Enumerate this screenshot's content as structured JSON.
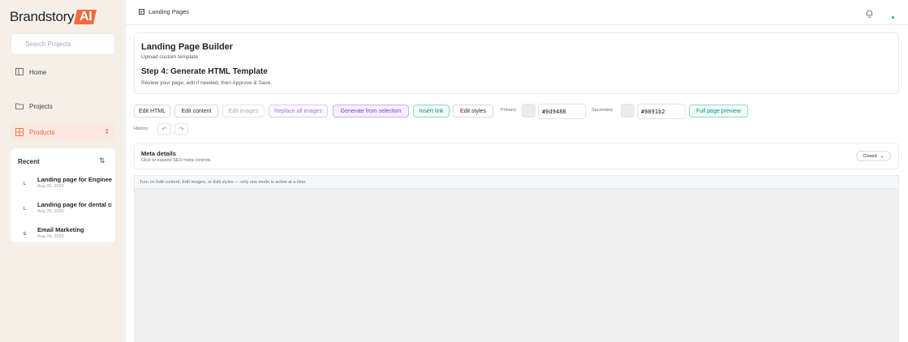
{
  "brand": {
    "name": "Brandstory",
    "ai_badge": "AI",
    "accent": "#f26b3a"
  },
  "sidebar": {
    "search_placeholder": "Search Projects",
    "nav": [
      {
        "label": "Home",
        "icon": "layout-icon"
      },
      {
        "label": "Projects",
        "icon": "folder-icon"
      },
      {
        "label": "Products",
        "icon": "grid-icon",
        "active": true
      }
    ],
    "recent": {
      "title": "Recent",
      "sort_icon": "sort-icon",
      "items": [
        {
          "initial": "L",
          "name": "Landing page for Engineer",
          "date": "Aug 26, 2026"
        },
        {
          "initial": "L",
          "name": "Landing page for dental cl",
          "date": "Aug 26, 2026"
        },
        {
          "initial": "E",
          "name": "Email Marketing",
          "date": "Aug 24, 2026"
        }
      ]
    }
  },
  "header": {
    "breadcrumb": "Landing Pages",
    "status_color": "#1fb27a"
  },
  "builder": {
    "title": "Landing Page Builder",
    "subtitle": "Upload custom template",
    "step": "Step 4: Generate HTML Template",
    "description": "Review your page, edit if needed, then Approve & Save."
  },
  "toolbar": {
    "edit_html": "Edit HTML",
    "edit_content": "Edit content",
    "edit_images": "Edit images",
    "replace_all_images": "Replace all images",
    "generate_from_selection": "Generate from selection",
    "insert_link": "Insert link",
    "edit_styles": "Edit styles",
    "primary_label": "Primary",
    "primary_value": "#0d9488",
    "secondary_label": "Secondary",
    "secondary_value": "#0891b2",
    "full_page_preview": "Full page preview"
  },
  "history": {
    "label": "History:",
    "undo_icon": "undo-icon",
    "redo_icon": "redo-icon"
  },
  "meta": {
    "title": "Meta details",
    "subtitle": "Click to expand SEO meta controls.",
    "state": "Closed"
  },
  "preview": {
    "note": "Turn on Edit content, Edit images, or Edit styles — only one mode is active at a time."
  }
}
